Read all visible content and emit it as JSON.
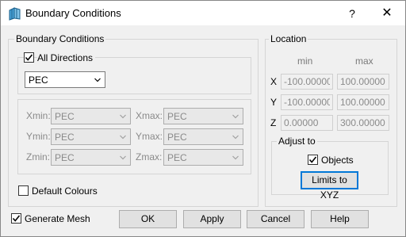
{
  "window": {
    "title": "Boundary Conditions",
    "help_label": "?",
    "close_label": "✕"
  },
  "bc_group": {
    "label": "Boundary Conditions",
    "all_directions": {
      "label": "All Directions",
      "checked": true
    },
    "all_combo": "PEC",
    "directions": [
      {
        "label": "Xmin:",
        "value": "PEC"
      },
      {
        "label": "Xmax:",
        "value": "PEC"
      },
      {
        "label": "Ymin:",
        "value": "PEC"
      },
      {
        "label": "Ymax:",
        "value": "PEC"
      },
      {
        "label": "Zmin:",
        "value": "PEC"
      },
      {
        "label": "Zmax:",
        "value": "PEC"
      }
    ],
    "default_colours": {
      "label": "Default Colours",
      "checked": false
    }
  },
  "location": {
    "label": "Location",
    "min_header": "min",
    "max_header": "max",
    "rows": [
      {
        "axis": "X",
        "min": "-100.00000",
        "max": "100.00000"
      },
      {
        "axis": "Y",
        "min": "-100.00000",
        "max": "100.00000"
      },
      {
        "axis": "Z",
        "min": "0.00000",
        "max": "300.00000"
      }
    ],
    "adjust": {
      "label": "Adjust to",
      "objects": {
        "label": "Objects",
        "checked": true
      },
      "limits_button": "Limits to XYZ"
    }
  },
  "generate_mesh": {
    "label": "Generate Mesh",
    "checked": true
  },
  "buttons": {
    "ok": "OK",
    "apply": "Apply",
    "cancel": "Cancel",
    "help": "Help"
  }
}
